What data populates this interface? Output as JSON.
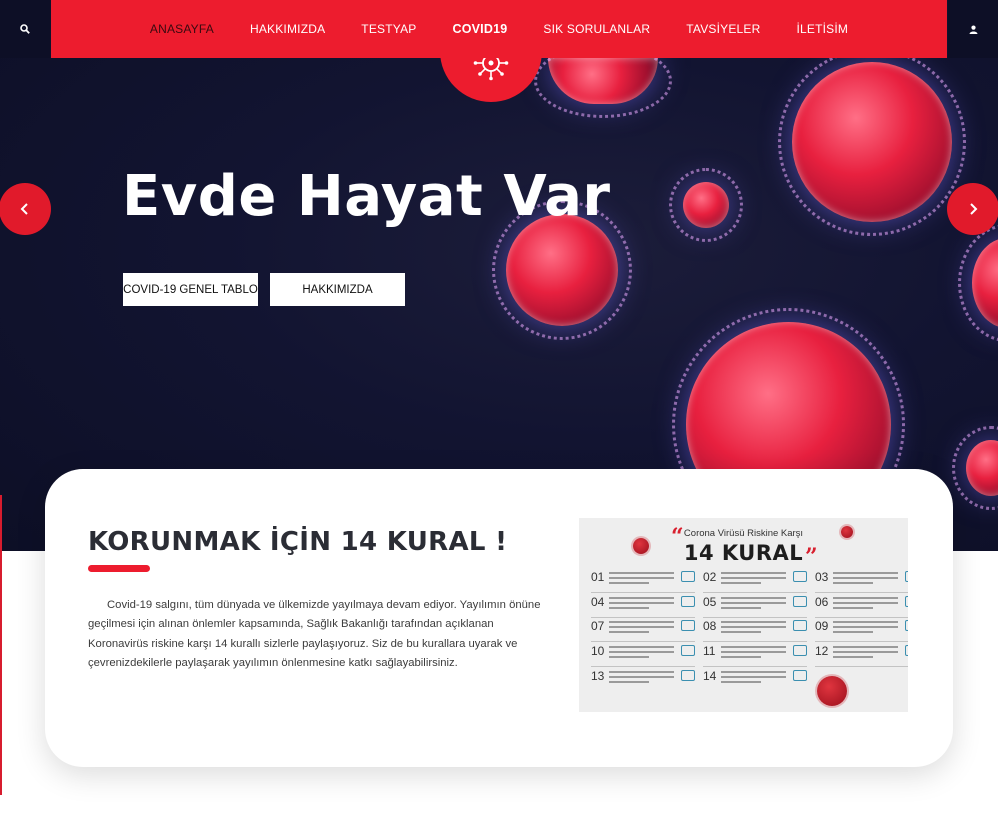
{
  "nav": {
    "items": [
      {
        "label": "ANASAYFA"
      },
      {
        "label": "HAKKIMIZDA"
      },
      {
        "label": "TESTYAP"
      },
      {
        "label": "COVID19"
      },
      {
        "label": "SIK SORULANLAR"
      },
      {
        "label": "TAVSİYELER"
      },
      {
        "label": "İLETİSİM"
      }
    ],
    "active_index": 3
  },
  "hero": {
    "title": "Evde Hayat Var",
    "buttons": {
      "table": "COVID-19 GENEL TABLO",
      "about": "HAKKIMIZDA"
    }
  },
  "content": {
    "title": "KORUNMAK İÇİN 14 KURAL !",
    "paragraph": "Covid-19 salgını, tüm dünyada ve ülkemizde yayılmaya devam ediyor. Yayılımın önüne geçilmesi için alınan önlemler kapsamında, Sağlık Bakanlığı tarafından açıklanan Koronavirüs riskine karşı 14 kurallı sizlerle paylaşıyoruz. Siz de bu kurallara uyarak ve çevrenizdekilerle paylaşarak yayılımın önlenmesine katkı sağlayabilirsiniz."
  },
  "infographic": {
    "header": "Corona Virüsü Riskine Karşı",
    "title": "14 KURAL",
    "numbers": [
      "01",
      "02",
      "03",
      "04",
      "05",
      "06",
      "07",
      "08",
      "09",
      "10",
      "11",
      "12",
      "13",
      "14"
    ]
  },
  "colors": {
    "brand_red": "#ed1c2e",
    "navy": "#0d0f26",
    "title_dark": "#2b2d35"
  },
  "icons": [
    "search-icon",
    "user-icon",
    "virus-icon",
    "chevron-left-icon",
    "chevron-right-icon"
  ]
}
